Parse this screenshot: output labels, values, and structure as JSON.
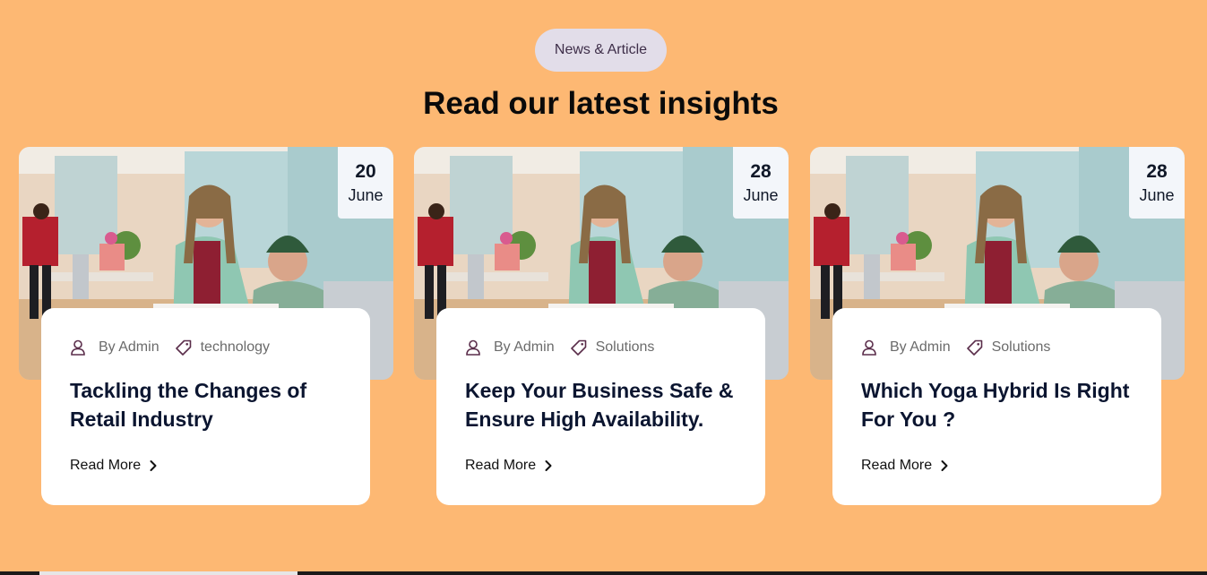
{
  "section": {
    "badge": "News & Article",
    "heading": "Read our latest insights"
  },
  "cards": [
    {
      "day": "20",
      "month": "June",
      "author": "By Admin",
      "tag": "technology",
      "title": "Tackling the Changes of Retail Industry",
      "read_more": "Read More"
    },
    {
      "day": "28",
      "month": "June",
      "author": "By Admin",
      "tag": "Solutions",
      "title": "Keep Your Business Safe & Ensure High Availability.",
      "read_more": "Read More"
    },
    {
      "day": "28",
      "month": "June",
      "author": "By Admin",
      "tag": "Solutions",
      "title": "Which Yoga Hybrid Is Right For You ?",
      "read_more": "Read More"
    }
  ],
  "icons": {
    "author": "user-icon",
    "tag": "tag-icon",
    "read_more": "chevron-right-icon"
  },
  "colors": {
    "background": "#FDB873",
    "badge_bg": "#E2DDE9",
    "card_bg": "#FFFFFF",
    "title": "#0B1530"
  }
}
